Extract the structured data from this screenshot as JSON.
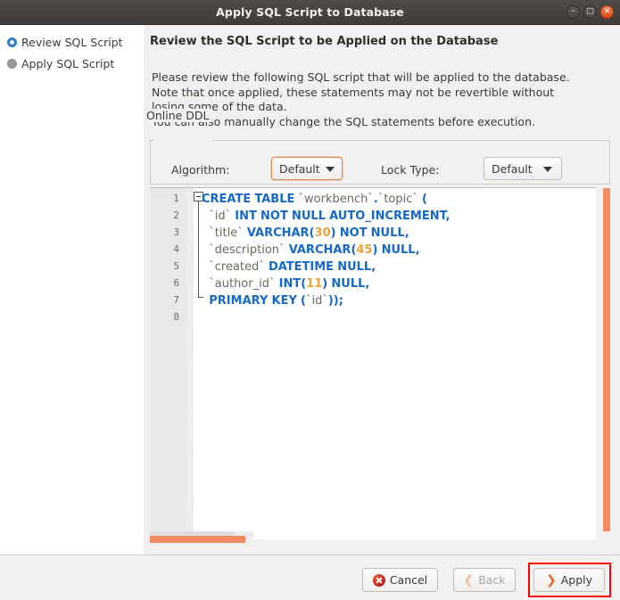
{
  "window": {
    "title": "Apply SQL Script to Database",
    "controls": {
      "minimize": "–",
      "maximize": "□",
      "close": "✕"
    }
  },
  "sidebar": {
    "steps": [
      {
        "label": "Review SQL Script",
        "state": "active"
      },
      {
        "label": "Apply SQL Script",
        "state": "pending"
      }
    ]
  },
  "main": {
    "title": "Review the SQL Script to be Applied on the Database",
    "description": "Please review the following SQL script that will be applied to the database.\nNote that once applied, these statements may not be revertible without\nlosing some of the data.\nYou can also manually change the SQL statements before execution.",
    "online_ddl": {
      "group_label": "Online DDL",
      "algorithm_label": "Algorithm:",
      "algorithm_value": "Default",
      "lock_type_label": "Lock Type:",
      "lock_type_value": "Default"
    },
    "editor": {
      "line_numbers": [
        "1",
        "2",
        "3",
        "4",
        "5",
        "6",
        "7",
        "8"
      ],
      "sql_lines": [
        "CREATE TABLE `workbench`.`topic` (",
        "  `id` INT NOT NULL AUTO_INCREMENT,",
        "  `title` VARCHAR(30) NOT NULL,",
        "  `description` VARCHAR(45) NULL,",
        "  `created` DATETIME NULL,",
        "  `author_id` INT(11) NULL,",
        "  PRIMARY KEY (`id`));",
        ""
      ],
      "sql_text": "CREATE TABLE `workbench`.`topic` (\n  `id` INT NOT NULL AUTO_INCREMENT,\n  `title` VARCHAR(30) NOT NULL,\n  `description` VARCHAR(45) NULL,\n  `created` DATETIME NULL,\n  `author_id` INT(11) NULL,\n  PRIMARY KEY (`id`));\n"
    }
  },
  "footer": {
    "cancel_label": "Cancel",
    "back_label": "Back",
    "apply_label": "Apply",
    "back_chevron": "❮",
    "apply_chevron": "❯"
  },
  "colors": {
    "accent_orange": "#f28b62",
    "keyword_blue": "#1569c7",
    "number_orange": "#e8a33d",
    "identifier_gray": "#6b6a5e",
    "highlight_red": "#ff0000",
    "panel_bg": "#f2f1f0"
  }
}
